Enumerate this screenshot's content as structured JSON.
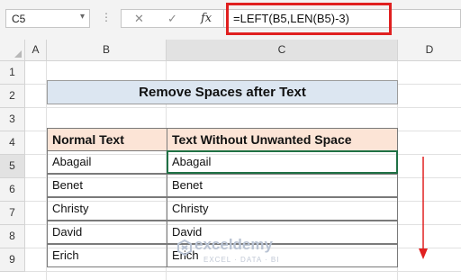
{
  "formula_bar": {
    "name_box": "C5",
    "formula": "=LEFT(B5,LEN(B5)-3)",
    "fx_label": "fx",
    "cancel_glyph": "✕",
    "enter_glyph": "✓"
  },
  "columns": [
    "A",
    "B",
    "C",
    "D"
  ],
  "rows": [
    "1",
    "2",
    "3",
    "4",
    "5",
    "6",
    "7",
    "8",
    "9"
  ],
  "sheet": {
    "title": "Remove Spaces after Text",
    "headers": [
      "Normal Text",
      "Text Without Unwanted Space"
    ],
    "data": [
      [
        "Abagail",
        "Abagail"
      ],
      [
        "Benet",
        "Benet"
      ],
      [
        "Christy",
        "Christy"
      ],
      [
        "David",
        "David"
      ],
      [
        "Erich",
        "Erich"
      ]
    ]
  },
  "watermark": {
    "brand": "exceldemy",
    "tagline": "EXCEL · DATA · BI"
  },
  "colors": {
    "title_fill": "#dce6f1",
    "header_fill": "#fce4d6",
    "highlight_red": "#e02020",
    "selection_green": "#1f7145"
  },
  "icons": {
    "namebox_dropdown": "chevron-down-icon",
    "arrow": "down-arrow-icon"
  }
}
